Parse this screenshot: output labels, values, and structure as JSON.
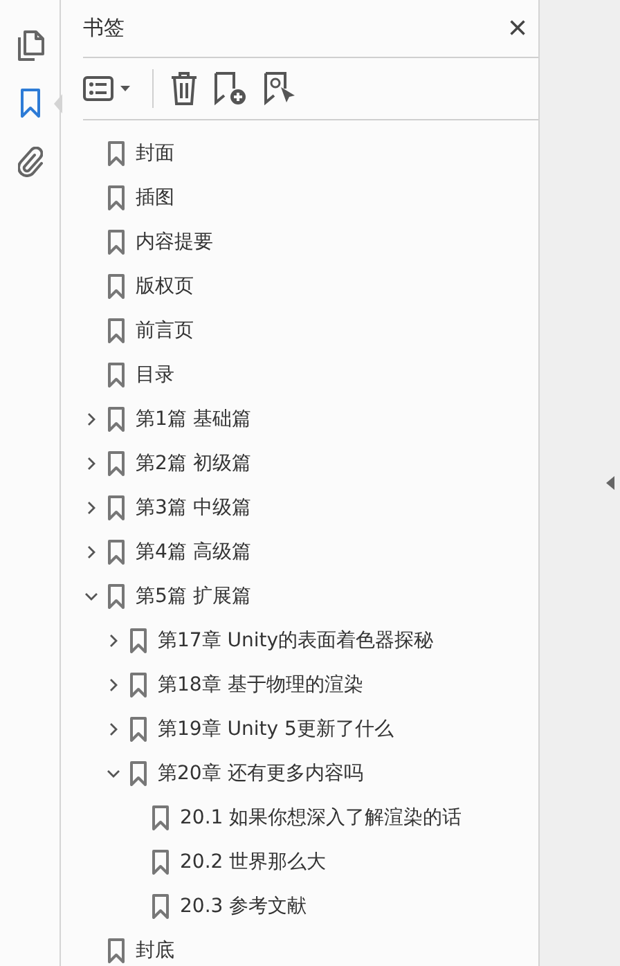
{
  "rail": [
    {
      "kind": "pages",
      "selected": false
    },
    {
      "kind": "bookmarks",
      "selected": true
    },
    {
      "kind": "attachments",
      "selected": false
    }
  ],
  "panel": {
    "title": "书签",
    "close": "×"
  },
  "bookmarks": [
    {
      "label": "封面"
    },
    {
      "label": "插图"
    },
    {
      "label": "内容提要"
    },
    {
      "label": "版权页"
    },
    {
      "label": "前言页"
    },
    {
      "label": "目录"
    },
    {
      "label": "第1篇 基础篇",
      "expanded": false
    },
    {
      "label": "第2篇 初级篇",
      "expanded": false
    },
    {
      "label": "第3篇 中级篇",
      "expanded": false
    },
    {
      "label": "第4篇 高级篇",
      "expanded": false
    },
    {
      "label": "第5篇 扩展篇",
      "expanded": true,
      "children": [
        {
          "label": "第17章 Unity的表面着色器探秘",
          "expanded": false
        },
        {
          "label": "第18章 基于物理的渲染",
          "expanded": false
        },
        {
          "label": "第19章 Unity 5更新了什么",
          "expanded": false
        },
        {
          "label": "第20章 还有更多内容吗",
          "expanded": true,
          "children": [
            {
              "label": "20.1 如果你想深入了解渲染的话"
            },
            {
              "label": "20.2 世界那么大"
            },
            {
              "label": "20.3 参考文献"
            }
          ]
        }
      ]
    },
    {
      "label": "封底"
    }
  ]
}
